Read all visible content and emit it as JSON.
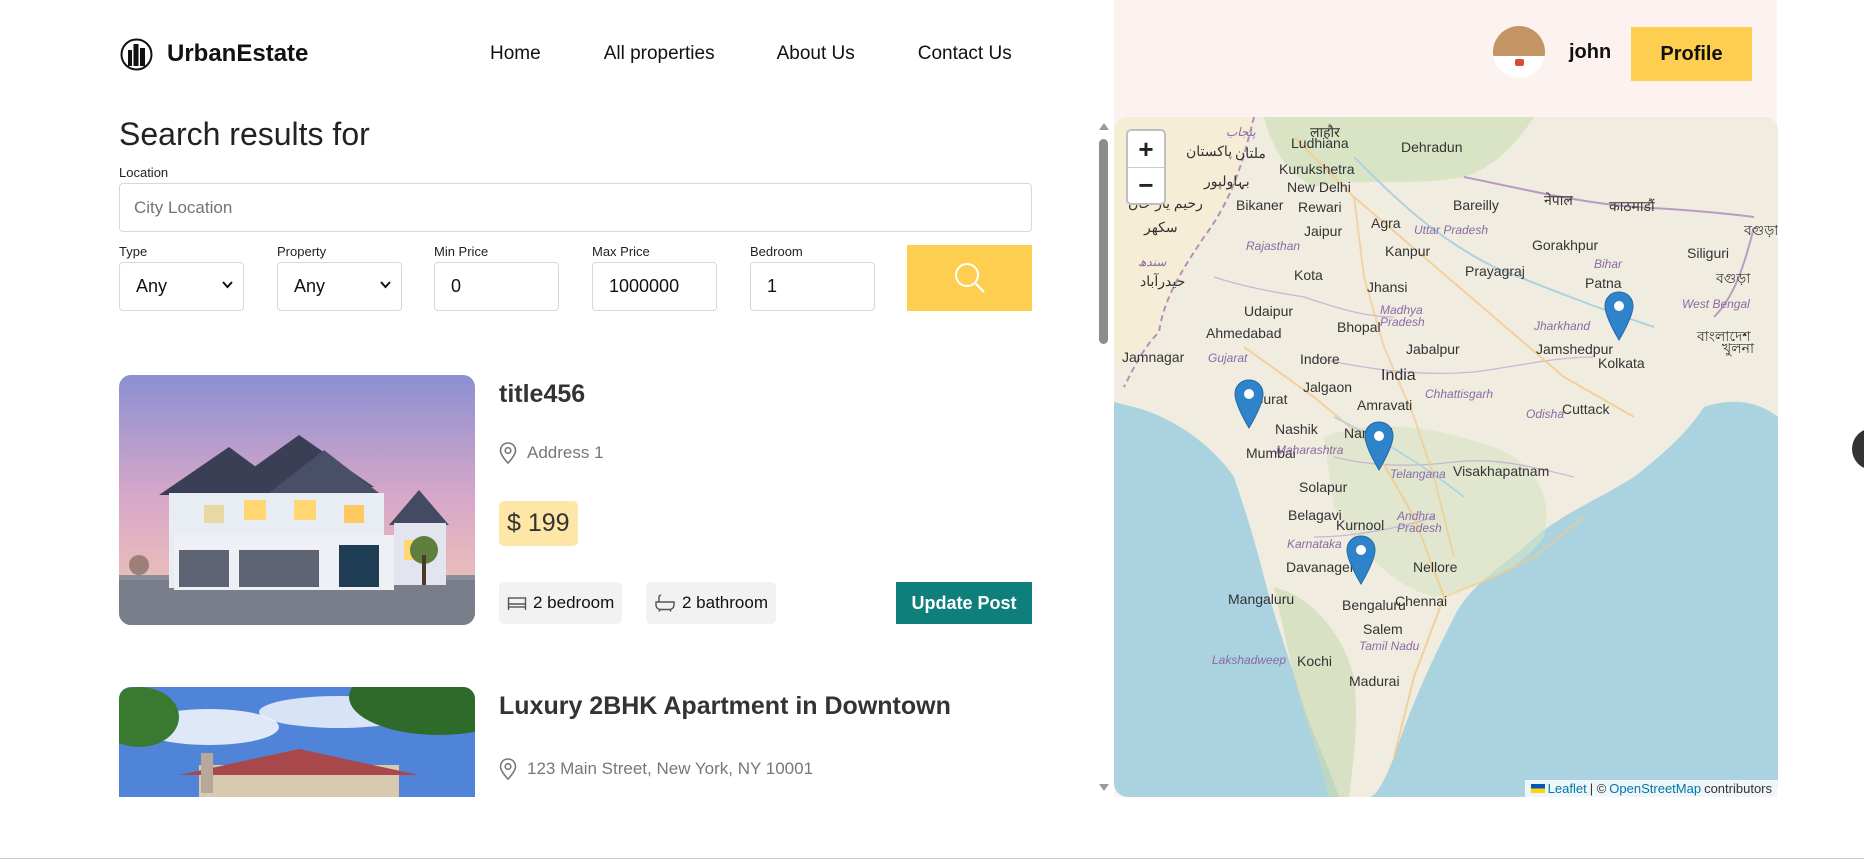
{
  "brand": {
    "name": "UrbanEstate",
    "logo_icon": "building-icon"
  },
  "nav": {
    "items": [
      "Home",
      "All properties",
      "About Us",
      "Contact Us"
    ]
  },
  "user": {
    "name": "john",
    "profile_label": "Profile"
  },
  "search": {
    "title": "Search results for",
    "location_label": "Location",
    "location_placeholder": "City Location",
    "type_label": "Type",
    "type_value": "Any",
    "property_label": "Property",
    "property_value": "Any",
    "min_price_label": "Min Price",
    "min_price_value": "0",
    "max_price_label": "Max Price",
    "max_price_value": "1000000",
    "bedroom_label": "Bedroom",
    "bedroom_value": "1",
    "button_icon": "search-icon"
  },
  "listings": [
    {
      "title": "title456",
      "address": "Address 1",
      "price": "$ 199",
      "bedrooms": "2 bedroom",
      "bathrooms": "2 bathroom",
      "action": "Update Post"
    },
    {
      "title": "Luxury 2BHK Apartment in Downtown",
      "address": "123 Main Street, New York, NY 10001"
    }
  ],
  "map": {
    "zoom_in": "+",
    "zoom_out": "−",
    "attribution_leaflet": "Leaflet",
    "attribution_sep": "| ©",
    "attribution_osm": "OpenStreetMap",
    "attribution_suffix": "contributors",
    "cities": [
      "Ludhiana",
      "Dehradun",
      "Kurukshetra",
      "New Delhi",
      "Bikaner",
      "Rewari",
      "Bareilly",
      "Jaipur",
      "Agra",
      "Kanpur",
      "Gorakhpur",
      "Siliguri",
      "Kota",
      "Prayagraj",
      "Patna",
      "Jhansi",
      "Udaipur",
      "Ahmedabad",
      "Bhopal",
      "Jabalpur",
      "Jamshedpur",
      "Jamnagar",
      "Indore",
      "India",
      "Kolkata",
      "Surat",
      "Jalgaon",
      "Amravati",
      "Nashik",
      "Cuttack",
      "Mumbai",
      "Nanded",
      "Solapur",
      "Visakhapatnam",
      "Belagavi",
      "Kurnool",
      "Davanagere",
      "Nellore",
      "Mangaluru",
      "Bengaluru",
      "Chennai",
      "Salem",
      "Kochi",
      "Madurai",
      "ملتان",
      "بہاولپور",
      "رحیم یار خان",
      "سکھر",
      "حیدرآباد",
      "سندھ",
      "پنجاب",
      "लाहौर",
      "नेपाल",
      "काठमाडौं",
      "বাংলাদেশ",
      "খুলনা",
      "বগুড়া"
    ],
    "regions": [
      "Uttar Pradesh",
      "Rajasthan",
      "Bihar",
      "Madhya Pradesh",
      "Jharkhand",
      "West Bengal",
      "Gujarat",
      "Chhattisgarh",
      "Odisha",
      "Maharashtra",
      "Telangana",
      "Andhra Pradesh",
      "Karnataka",
      "Tamil Nadu",
      "Lakshadweep"
    ],
    "marker_icon": "map-pin-icon",
    "marker_count": 4
  },
  "colors": {
    "accent": "#fece51",
    "teal": "#0e7f7b",
    "price_bg": "#fde6a6",
    "panel_bg": "#fcf2f0"
  }
}
